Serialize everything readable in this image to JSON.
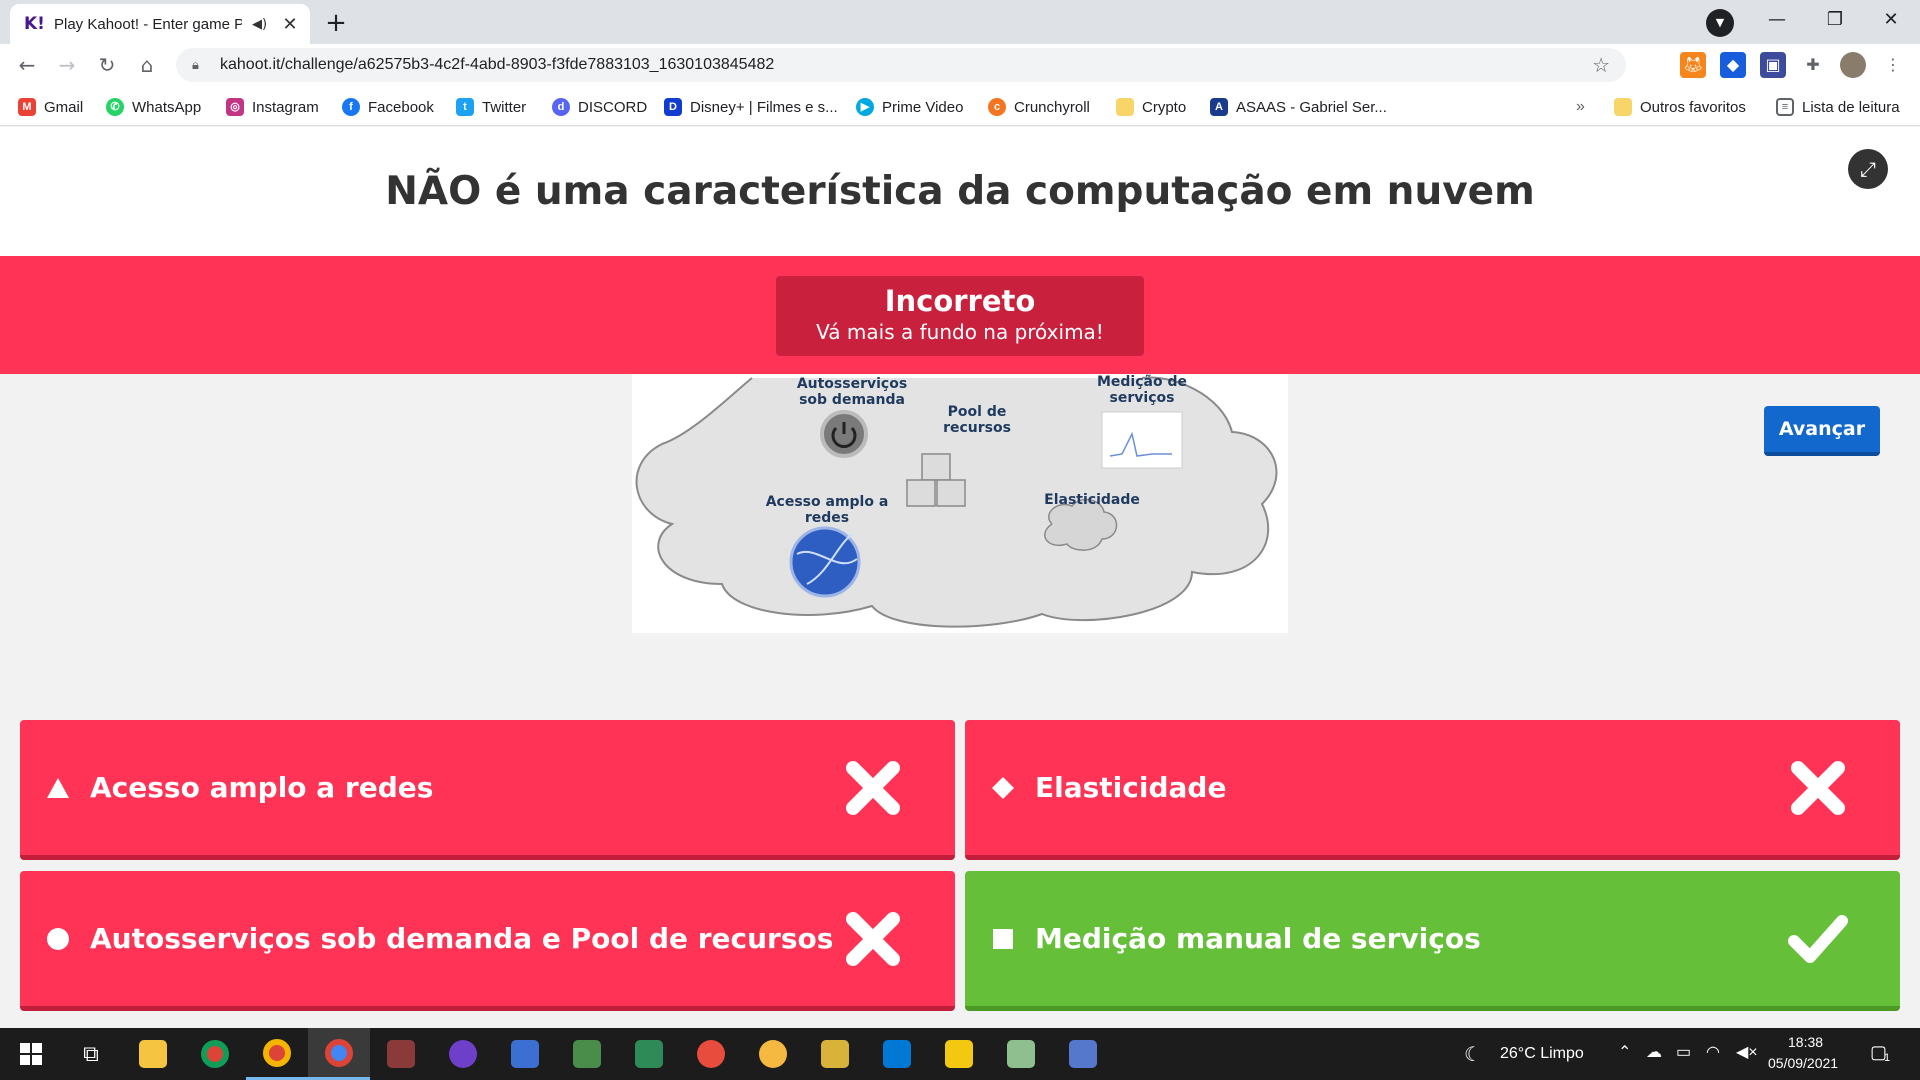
{
  "browser": {
    "tab_title": "Play Kahoot! - Enter game PI",
    "tab_favicon": "K!",
    "url": "kahoot.it/challenge/a62575b3-4c2f-4abd-8903-f3fde7883103_1630103845482",
    "bookmarks": [
      {
        "label": "Gmail",
        "icon": "gmail-icon",
        "color": "#ea4335"
      },
      {
        "label": "WhatsApp",
        "icon": "whatsapp-icon",
        "color": "#25d366"
      },
      {
        "label": "Instagram",
        "icon": "instagram-icon",
        "color": "#c13584"
      },
      {
        "label": "Facebook",
        "icon": "facebook-icon",
        "color": "#1877f2"
      },
      {
        "label": "Twitter",
        "icon": "twitter-icon",
        "color": "#1da1f2"
      },
      {
        "label": "DISCORD",
        "icon": "discord-icon",
        "color": "#5865f2"
      },
      {
        "label": "Disney+ | Filmes e s...",
        "icon": "disney-icon",
        "color": "#113ccf"
      },
      {
        "label": "Prime Video",
        "icon": "prime-video-icon",
        "color": "#00a8e1"
      },
      {
        "label": "Crunchyroll",
        "icon": "crunchyroll-icon",
        "color": "#f47521"
      },
      {
        "label": "Crypto",
        "icon": "folder-icon",
        "color": "#f8d568"
      },
      {
        "label": "ASAAS - Gabriel Ser...",
        "icon": "asaas-icon",
        "color": "#1a3b8c"
      }
    ],
    "more_bookmarks": "»",
    "other_favorites": "Outros favoritos",
    "reading_list": "Lista de leitura"
  },
  "question": {
    "title": "NÃO é uma característica da computação em nuvem"
  },
  "result": {
    "title": "Incorreto",
    "subtitle": "Vá mais a fundo na próxima!"
  },
  "diagram": {
    "labels": {
      "autoservicos": "Autosserviços sob demanda",
      "pool": "Pool de recursos",
      "medicao": "Medição de serviços",
      "acesso": "Acesso amplo a redes",
      "elasticidade": "Elasticidade"
    }
  },
  "next_button": "Avançar",
  "answers": [
    {
      "text": "Acesso amplo a redes",
      "shape": "triangle",
      "correct": false
    },
    {
      "text": "Elasticidade",
      "shape": "diamond",
      "correct": false
    },
    {
      "text": "Autosserviços sob demanda e Pool de recursos",
      "shape": "circle",
      "correct": false
    },
    {
      "text": "Medição manual de serviços",
      "shape": "square",
      "correct": true
    }
  ],
  "colors": {
    "wrong": "#ff3355",
    "correct": "#66bf39",
    "button": "#1368ce"
  },
  "taskbar": {
    "weather": "26°C  Limpo",
    "time": "18:38",
    "date": "05/09/2021",
    "notifications": "1"
  }
}
